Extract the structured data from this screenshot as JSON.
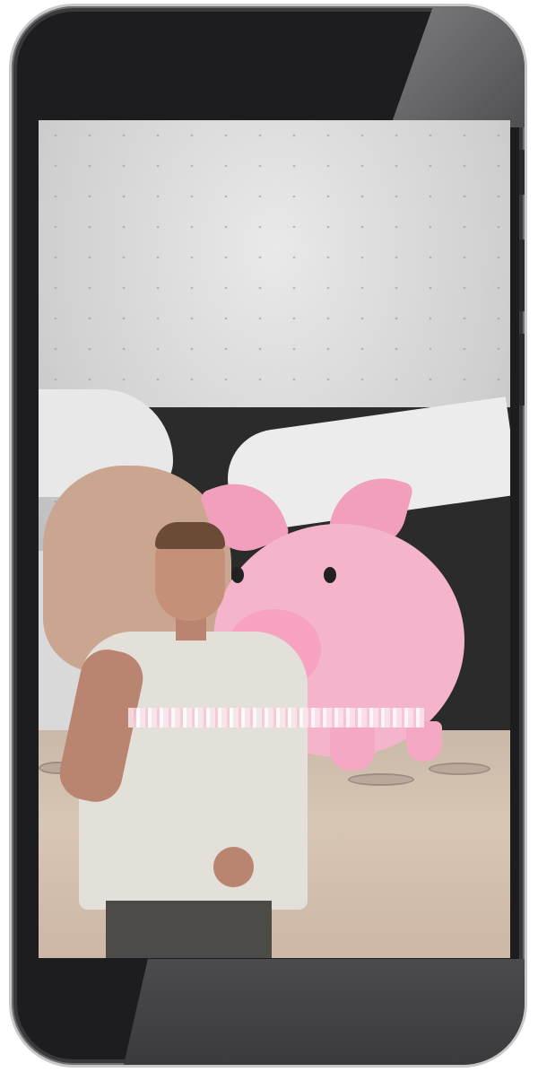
{
  "device": {
    "frame_color": "#1d1d1f",
    "bezel_color": "#c9c9cc"
  },
  "screen": {
    "content": "video-frame",
    "scene_colors": {
      "sweater": "#e0e0e0",
      "piggy_bank": "#f4b4cb",
      "table": "#d8c6b4"
    }
  }
}
